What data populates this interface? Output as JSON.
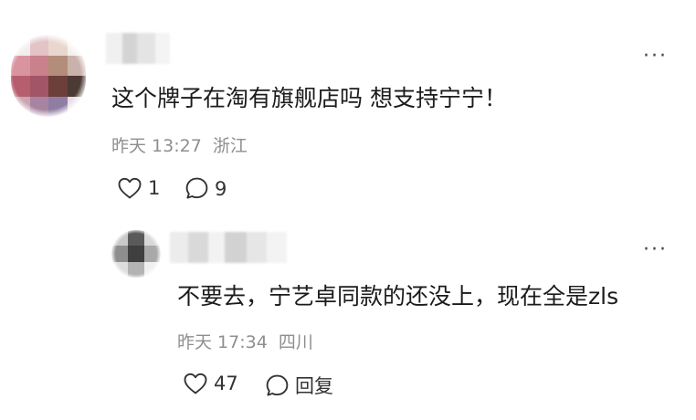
{
  "colors": {
    "text": "#1b1b1b",
    "meta": "#8f8f8f",
    "icon": "#333333",
    "background": "#ffffff"
  },
  "comment": {
    "more_label": "···",
    "content": "这个牌子在淘有旗舰店吗 想支持宁宁！",
    "time": "昨天 13:27",
    "location": "浙江",
    "likes": "1",
    "replies": "9"
  },
  "reply": {
    "more_label": "···",
    "content": "不要去，宁艺卓同款的还没上，现在全是zls",
    "time": "昨天 17:34",
    "location": "四川",
    "likes": "47",
    "reply_label": "回复"
  }
}
